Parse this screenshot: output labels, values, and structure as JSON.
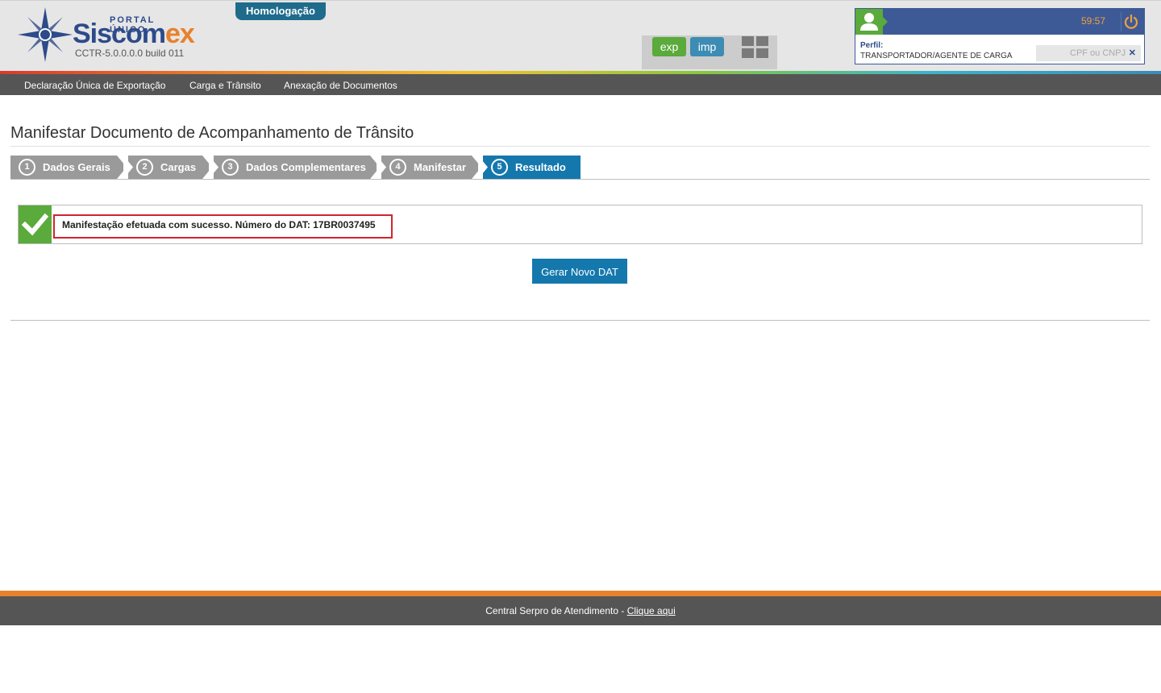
{
  "header": {
    "logo": {
      "portal": "PORTAL ÚNICO",
      "name_part1": "Siscom",
      "name_part2": "ex",
      "version": "CCTR-5.0.0.0.0  build 011"
    },
    "environment_badge": "Homologação",
    "app_buttons": {
      "exp": "exp",
      "imp": "imp"
    },
    "apps_icon": "grid-icon"
  },
  "user_panel": {
    "session_time": "59:57",
    "perfil_label": "Perfil:",
    "perfil_value": "TRANSPORTADOR/AGENTE DE CARGA",
    "cpf_placeholder": "CPF ou CNPJ",
    "cpf_clear": "✕"
  },
  "menu": {
    "items": [
      {
        "label": "Declaração Única de Exportação"
      },
      {
        "label": "Carga e Trânsito"
      },
      {
        "label": "Anexação de Documentos"
      }
    ]
  },
  "page": {
    "title": "Manifestar Documento de Acompanhamento de Trânsito"
  },
  "wizard": {
    "steps": [
      {
        "num": "1",
        "label": "Dados Gerais",
        "active": false
      },
      {
        "num": "2",
        "label": "Cargas",
        "active": false
      },
      {
        "num": "3",
        "label": "Dados Complementares",
        "active": false
      },
      {
        "num": "4",
        "label": "Manifestar",
        "active": false
      },
      {
        "num": "5",
        "label": "Resultado",
        "active": true
      }
    ]
  },
  "result": {
    "message": "Manifestação efetuada com sucesso. Número do DAT: 17BR0037495",
    "button_label": "Gerar Novo DAT"
  },
  "footer": {
    "text": "Central Serpro de Atendimento - ",
    "link": "Clique aqui"
  },
  "colors": {
    "brand_blue": "#2d4a8a",
    "accent_orange": "#e8812c",
    "primary": "#1478ad",
    "success": "#5aaa3c",
    "highlight_red": "#d0262d",
    "menu_bg": "#555555"
  }
}
